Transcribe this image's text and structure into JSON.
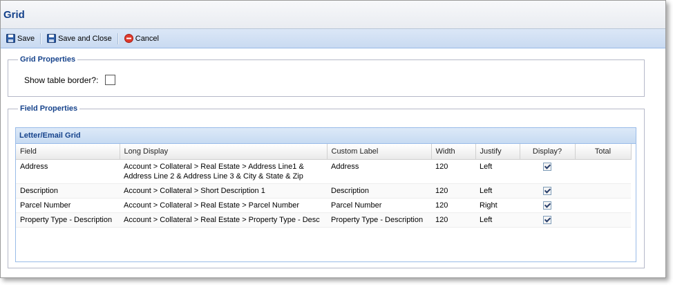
{
  "window": {
    "title": "Grid"
  },
  "toolbar": {
    "save_label": "Save",
    "save_close_label": "Save and Close",
    "cancel_label": "Cancel"
  },
  "grid_properties": {
    "legend": "Grid Properties",
    "show_border_label": "Show table border?:",
    "show_border_checked": false
  },
  "field_properties": {
    "legend": "Field Properties",
    "panel_title": "Letter/Email Grid",
    "columns": [
      "Field",
      "Long Display",
      "Custom Label",
      "Width",
      "Justify",
      "Display?",
      "Total"
    ],
    "rows": [
      {
        "field": "Address",
        "long_display_1": "Account > Collateral > Real Estate > Address Line1 &",
        "long_display_2": "Address Line 2 & Address Line 3 & City & State & Zip",
        "custom_label": "Address",
        "width": "120",
        "justify": "Left",
        "display": true,
        "total": ""
      },
      {
        "field": "Description",
        "long_display_1": "Account > Collateral > Short Description 1",
        "long_display_2": "",
        "custom_label": "Description",
        "width": "120",
        "justify": "Left",
        "display": true,
        "total": ""
      },
      {
        "field": "Parcel Number",
        "long_display_1": "Account > Collateral > Real Estate > Parcel Number",
        "long_display_2": "",
        "custom_label": "Parcel Number",
        "width": "120",
        "justify": "Right",
        "display": true,
        "total": ""
      },
      {
        "field": "Property Type - Description",
        "long_display_1": "Account > Collateral > Real Estate > Property Type - Desc",
        "long_display_2": "",
        "custom_label": "Property Type - Description",
        "width": "120",
        "justify": "Left",
        "display": true,
        "total": ""
      }
    ]
  }
}
